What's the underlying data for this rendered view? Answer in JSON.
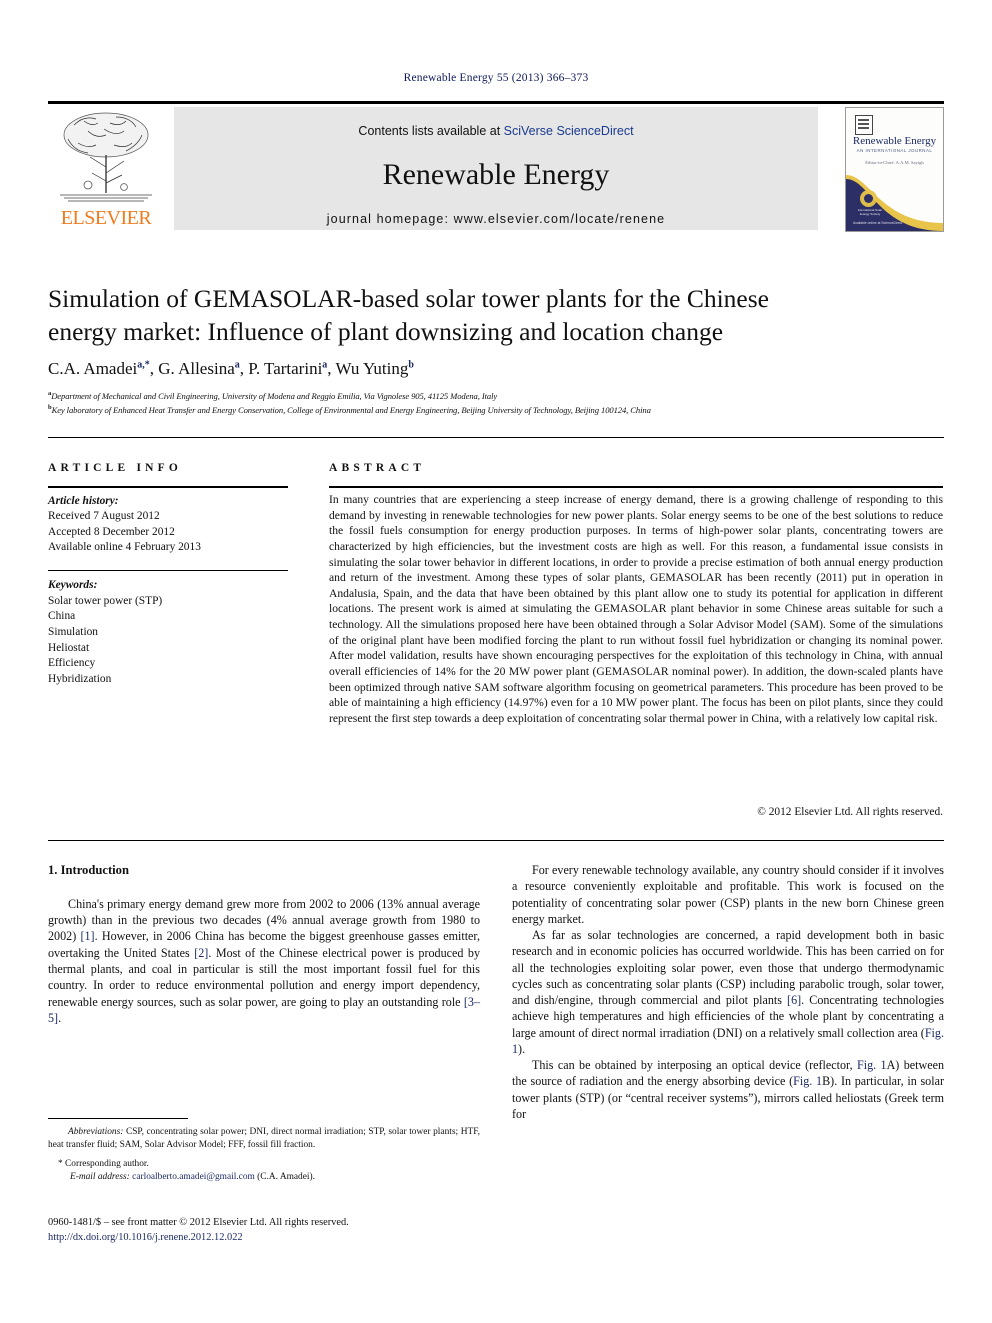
{
  "running_head": "Renewable Energy 55 (2013) 366–373",
  "header": {
    "publisher_name": "ELSEVIER",
    "contents_prefix": "Contents lists available at ",
    "contents_link": "SciVerse ScienceDirect",
    "journal_title": "Renewable Energy",
    "homepage": "journal homepage: www.elsevier.com/locate/renene",
    "cover": {
      "title": "Renewable Energy",
      "subtitle": "AN INTERNATIONAL JOURNAL",
      "editors": "Editor-in-Chief:  A.A.M. Sayigh",
      "badge_caption": "International Solar Energy Society",
      "bottom_line": "Available online at\nScienceDirect"
    }
  },
  "article": {
    "title": "Simulation of GEMASOLAR-based solar tower plants for the Chinese energy market: Influence of plant downsizing and location change",
    "authors": [
      {
        "name": "C.A. Amadei",
        "marks": "a,*"
      },
      {
        "name": "G. Allesina",
        "marks": "a"
      },
      {
        "name": "P. Tartarini",
        "marks": "a"
      },
      {
        "name": "Wu Yuting",
        "marks": "b"
      }
    ],
    "affiliations": [
      {
        "mark": "a",
        "text": "Department of Mechanical and Civil Engineering, University of Modena and Reggio Emilia, Via Vignolese 905, 41125 Modena, Italy"
      },
      {
        "mark": "b",
        "text": "Key laboratory of Enhanced Heat Transfer and Energy Conservation, College of Environmental and Energy Engineering, Beijing University of Technology, Beijing 100124, China"
      }
    ]
  },
  "article_info": {
    "heading": "ARTICLE INFO",
    "history_label": "Article history:",
    "history": [
      "Received 7 August 2012",
      "Accepted 8 December 2012",
      "Available online 4 February 2013"
    ],
    "keywords_label": "Keywords:",
    "keywords": [
      "Solar tower power (STP)",
      "China",
      "Simulation",
      "Heliostat",
      "Efficiency",
      "Hybridization"
    ]
  },
  "abstract": {
    "heading": "ABSTRACT",
    "text": "In many countries that are experiencing a steep increase of energy demand, there is a growing challenge of responding to this demand by investing in renewable technologies for new power plants. Solar energy seems to be one of the best solutions to reduce the fossil fuels consumption for energy production purposes. In terms of high-power solar plants, concentrating towers are characterized by high efficiencies, but the investment costs are high as well. For this reason, a fundamental issue consists in simulating the solar tower behavior in different locations, in order to provide a precise estimation of both annual energy production and return of the investment. Among these types of solar plants, GEMASOLAR has been recently (2011) put in operation in Andalusia, Spain, and the data that have been obtained by this plant allow one to study its potential for application in different locations. The present work is aimed at simulating the GEMASOLAR plant behavior in some Chinese areas suitable for such a technology. All the simulations proposed here have been obtained through a Solar Advisor Model (SAM). Some of the simulations of the original plant have been modified forcing the plant to run without fossil fuel hybridization or changing its nominal power. After model validation, results have shown encouraging perspectives for the exploitation of this technology in China, with annual overall efficiencies of 14% for the 20 MW power plant (GEMASOLAR nominal power). In addition, the down-scaled plants have been optimized through native SAM software algorithm focusing on geometrical parameters. This procedure has been proved to be able of maintaining a high efficiency (14.97%) even for a 10 MW power plant. The focus has been on pilot plants, since they could represent the first step towards a deep exploitation of concentrating solar thermal power in China, with a relatively low capital risk.",
    "copyright": "© 2012 Elsevier Ltd. All rights reserved."
  },
  "body": {
    "section_number_title": "1. Introduction",
    "left_p1_a": "China's primary energy demand grew more from 2002 to 2006 (13% annual average growth) than in the previous two decades (4% annual average growth from 1980 to 2002) ",
    "left_p1_ref1": "[1]",
    "left_p1_b": ". However, in 2006 China has become the biggest greenhouse gasses emitter, overtaking the United States ",
    "left_p1_ref2": "[2]",
    "left_p1_c": ". Most of the Chinese electrical power is produced by thermal plants, and coal in particular is still the most important fossil fuel for this country. In order to reduce environmental pollution and energy import dependency, renewable energy sources, such as solar power, are going to play an outstanding role ",
    "left_p1_ref3": "[3–5]",
    "left_p1_d": ".",
    "right_p1": "For every renewable technology available, any country should consider if it involves a resource conveniently exploitable and profitable. This work is focused on the potentiality of concentrating solar power (CSP) plants in the new born Chinese green energy market.",
    "right_p2_a": "As far as solar technologies are concerned, a rapid development both in basic research and in economic policies has occurred worldwide. This has been carried on for all the technologies exploiting solar power, even those that undergo thermodynamic cycles such as concentrating solar plants (CSP) including parabolic trough, solar tower, and dish/engine, through commercial and pilot plants ",
    "right_p2_ref1": "[6]",
    "right_p2_b": ". Concentrating technologies achieve high temperatures and high efficiencies of the whole plant by concentrating a large amount of direct normal irradiation (DNI) on a relatively small collection area (",
    "right_p2_fig1": "Fig. 1",
    "right_p2_c": ").",
    "right_p3_a": "This can be obtained by interposing an optical device (reflector, ",
    "right_p3_figA": "Fig. 1",
    "right_p3_b": "A) between the source of radiation and the energy absorbing device (",
    "right_p3_figB": "Fig. 1",
    "right_p3_c": "B). In particular, in solar tower plants (STP) (or “central receiver systems”), mirrors called heliostats (Greek term for"
  },
  "footnotes": {
    "abbreviations_label": "Abbreviations:",
    "abbreviations_text": " CSP, concentrating solar power; DNI, direct normal irradiation; STP, solar tower plants; HTF, heat transfer fluid; SAM, Solar Advisor Model; FFF, fossil fill fraction.",
    "corresponding": "* Corresponding author.",
    "email_label": "E-mail address:",
    "email": "carloalberto.amadei@gmail.com",
    "email_owner": " (C.A. Amadei).",
    "imprint": "0960-1481/$ – see front matter © 2012 Elsevier Ltd. All rights reserved.",
    "doi": "http://dx.doi.org/10.1016/j.renene.2012.12.022"
  },
  "colors": {
    "link_blue": "#1b2a63",
    "elsevier_orange": "#ef7c20",
    "band_gray": "#e6e6e6",
    "cover_navy": "#2b2f66"
  }
}
